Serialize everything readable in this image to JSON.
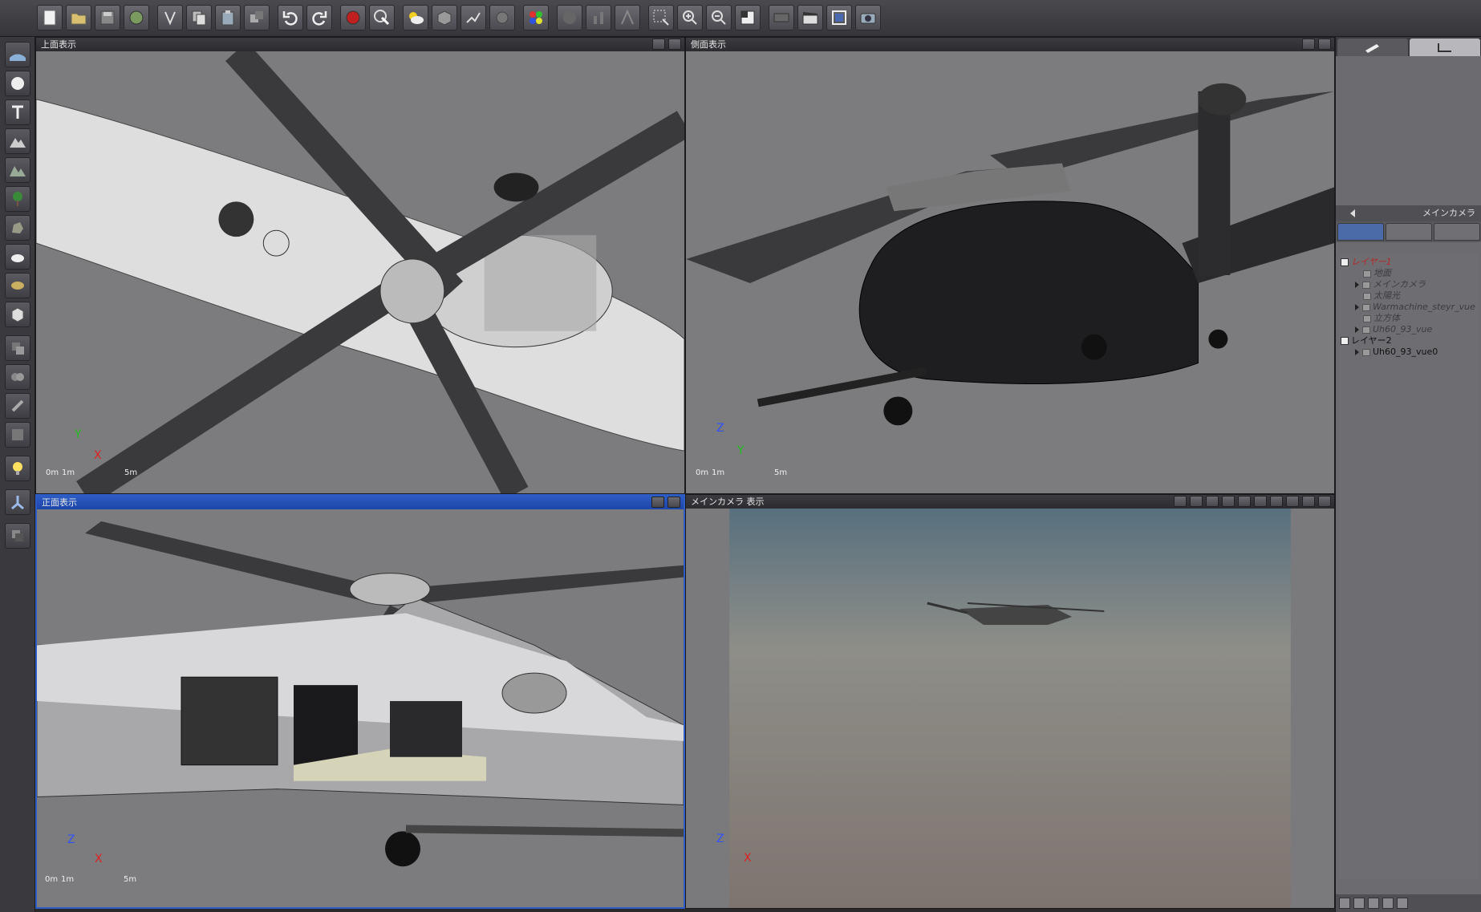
{
  "viewports": {
    "top": {
      "title": "上面表示",
      "axis_a": "Y",
      "axis_b": "X",
      "scale_0": "0m",
      "scale_1": "1m",
      "scale_5": "5m"
    },
    "side": {
      "title": "側面表示",
      "axis_a": "Z",
      "axis_b": "Y",
      "scale_0": "0m",
      "scale_1": "1m",
      "scale_5": "5m"
    },
    "front": {
      "title": "正面表示",
      "axis_a": "Z",
      "axis_b": "X",
      "scale_0": "0m",
      "scale_1": "1m",
      "scale_5": "5m"
    },
    "camera": {
      "title": "メインカメラ 表示",
      "axis_a": "Z",
      "axis_b": "X"
    }
  },
  "right_panel": {
    "camera_name": "メインカメラ",
    "tree": [
      {
        "label": "レイヤー1",
        "kind": "layer"
      },
      {
        "label": "地面",
        "kind": "dim"
      },
      {
        "label": "メインカメラ",
        "kind": "dim"
      },
      {
        "label": "太陽光",
        "kind": "dim"
      },
      {
        "label": "Warmachine_steyr_vue",
        "kind": "dim"
      },
      {
        "label": "立方体",
        "kind": "dim"
      },
      {
        "label": "Uh60_93_vue",
        "kind": "dim"
      },
      {
        "label": "レイヤー2",
        "kind": "layer2"
      },
      {
        "label": "Uh60_93_vue0",
        "kind": "obj"
      }
    ]
  },
  "colors": {
    "active_header": "#2d5cc4",
    "viewport_bg": "#7c7c7e",
    "layer_red": "#b02a2a",
    "axis_red": "#e02020",
    "axis_green": "#20c020",
    "axis_blue": "#3050ff"
  },
  "icons": {
    "toolbar": [
      "new-document-icon",
      "open-folder-icon",
      "save-icon",
      "import-icon",
      "export-icon",
      "copy-icon",
      "paste-icon",
      "duplicate-icon",
      "undo-icon",
      "redo-icon",
      "render-icon",
      "render-area-icon",
      "atmosphere-icon",
      "object-library-icon",
      "material-icon",
      "brush-icon",
      "color-balls-icon",
      "sphere-icon",
      "bars-icon",
      "light-icon",
      "zoom-region-icon",
      "zoom-in-icon",
      "zoom-out-icon",
      "fit-view-icon",
      "animation-icon",
      "clapboard-icon",
      "frame-icon",
      "camera-icon"
    ],
    "left": [
      "terrain-icon",
      "sphere-icon",
      "text-icon",
      "mountain-icon",
      "mountain-alt-icon",
      "tree-icon",
      "rock-icon",
      "cloud-icon",
      "plant-icon",
      "cube-icon",
      "boolean-icon",
      "metablob-icon",
      "link-icon",
      "group-icon",
      "light-bulb-icon",
      "gizmo-icon",
      "layers-icon"
    ]
  }
}
